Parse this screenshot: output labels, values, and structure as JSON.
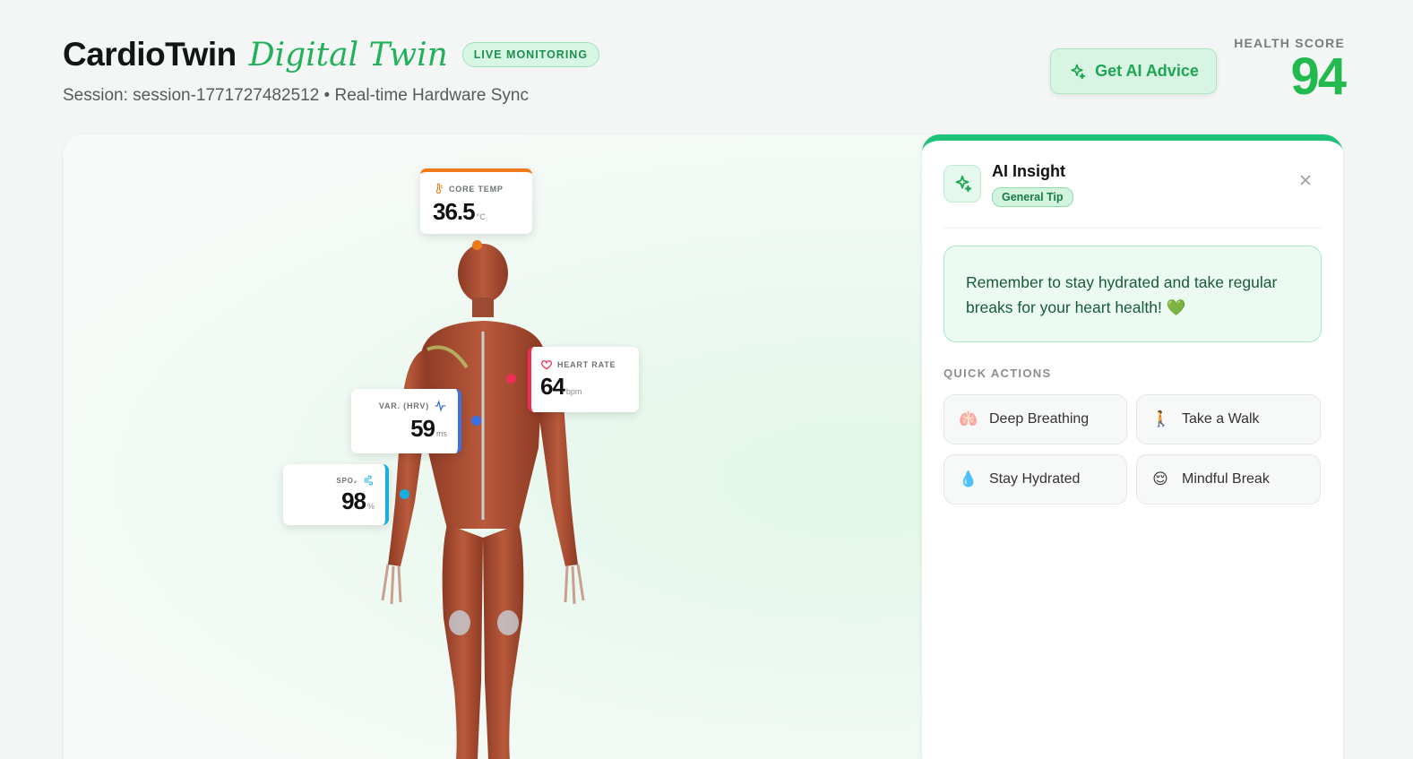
{
  "header": {
    "brand": "CardioTwin",
    "brand_sub": "Digital Twin",
    "live_badge": "LIVE MONITORING",
    "session": "Session: session-1771727482512 • Real-time Hardware Sync",
    "advice_button": "Get AI Advice",
    "health_score_label": "HEALTH SCORE",
    "health_score": "94"
  },
  "metrics": {
    "core_temp": {
      "label": "CORE TEMP",
      "value": "36.5",
      "unit": "°C",
      "color": "#f07a1a",
      "icon": "thermometer-icon"
    },
    "heart_rate": {
      "label": "HEART RATE",
      "value": "64",
      "unit": "bpm",
      "color": "#ee2e55",
      "icon": "heart-icon"
    },
    "hrv": {
      "label": "VAR. (HRV)",
      "value": "59",
      "unit": "ms",
      "color": "#3b6fe8",
      "icon": "pulse-icon"
    },
    "spo2": {
      "label": "SPO₂",
      "value": "98",
      "unit": "%",
      "color": "#18aee0",
      "icon": "wind-icon"
    }
  },
  "panel": {
    "title": "AI Insight",
    "badge": "General Tip",
    "insight": "Remember to stay hydrated and take regular breaks for your heart health! 💚",
    "quick_actions_label": "QUICK ACTIONS",
    "quick_actions": [
      {
        "emoji": "🫁",
        "label": "Deep Breathing"
      },
      {
        "emoji": "🚶",
        "label": "Take a Walk"
      },
      {
        "emoji": "💧",
        "label": "Stay Hydrated"
      },
      {
        "emoji": "😌",
        "label": "Mindful Break"
      }
    ]
  },
  "colors": {
    "accent": "#22b05a",
    "panel_top": "#1fc27a"
  }
}
